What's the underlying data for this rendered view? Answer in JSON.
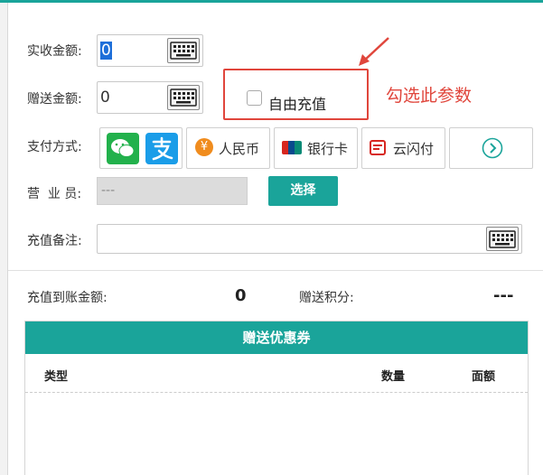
{
  "form": {
    "received_label": "实收金额:",
    "received_value": "0",
    "gift_label": "赠送金额:",
    "gift_value": "0",
    "custom_recharge_label": "自由充值",
    "payment_label": "支付方式:",
    "payment_methods": [
      {
        "label": "人民币",
        "icon": "rmb-icon"
      },
      {
        "label": "银行卡",
        "icon": "unionpay-card-icon"
      },
      {
        "label": "云闪付",
        "icon": "cloud-quickpass-icon"
      }
    ],
    "clerk_label": "营  业 员:",
    "clerk_placeholder": "---",
    "select_button": "选择",
    "remark_label": "充值备注:"
  },
  "annotation": {
    "text": "勾选此参数",
    "color": "#e0463c"
  },
  "summary": {
    "credited_label": "充值到账金额:",
    "credited_value": "0",
    "points_label": "赠送积分:",
    "points_value": "---"
  },
  "coupon": {
    "title": "赠送优惠券",
    "columns": [
      "类型",
      "数量",
      "面额"
    ]
  },
  "colors": {
    "accent": "#1aa49a",
    "annotation": "#e0463c",
    "wechat": "#22b14c",
    "alipay": "#1a9de8"
  }
}
